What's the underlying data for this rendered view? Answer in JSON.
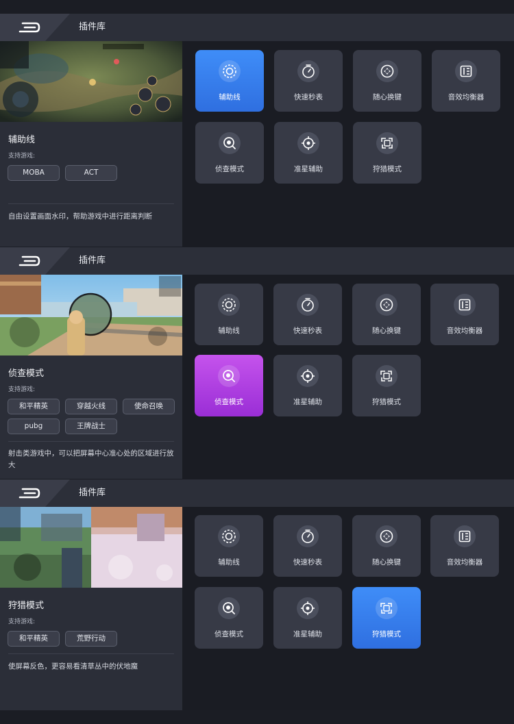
{
  "colors": {
    "accent_blue": "#3a86f4",
    "accent_purple": "#b444e4",
    "panel_bg": "#2b2e38",
    "page_bg": "#1a1c23"
  },
  "panels": [
    {
      "header_title": "插件库",
      "detail": {
        "title": "辅助线",
        "support_label": "支持游戏:",
        "games": [
          "MOBA",
          "ACT"
        ],
        "description": "自由设置画面水印，帮助游戏中进行距离判断"
      },
      "selected_plugin": "辅助线",
      "selected_color": "blue"
    },
    {
      "header_title": "插件库",
      "detail": {
        "title": "侦查模式",
        "support_label": "支持游戏:",
        "games": [
          "和平精英",
          "穿越火线",
          "使命召唤",
          "pubg",
          "王牌战士"
        ],
        "description": "射击类游戏中，可以把屏幕中心准心处的区域进行放大"
      },
      "selected_plugin": "侦查模式",
      "selected_color": "purple"
    },
    {
      "header_title": "插件库",
      "detail": {
        "title": "狩猎模式",
        "support_label": "支持游戏:",
        "games": [
          "和平精英",
          "荒野行动"
        ],
        "description": "使屏幕反色，更容易看清草丛中的伏地魔"
      },
      "selected_plugin": "狩猎模式",
      "selected_color": "blue"
    }
  ],
  "plugins": [
    {
      "label": "辅助线",
      "icon": "guideline-icon"
    },
    {
      "label": "快速秒表",
      "icon": "stopwatch-icon"
    },
    {
      "label": "随心换键",
      "icon": "keymap-icon"
    },
    {
      "label": "音效均衡器",
      "icon": "equalizer-icon"
    },
    {
      "label": "侦查模式",
      "icon": "scout-icon"
    },
    {
      "label": "准星辅助",
      "icon": "crosshair-icon"
    },
    {
      "label": "狩猎模式",
      "icon": "hunt-icon"
    }
  ]
}
